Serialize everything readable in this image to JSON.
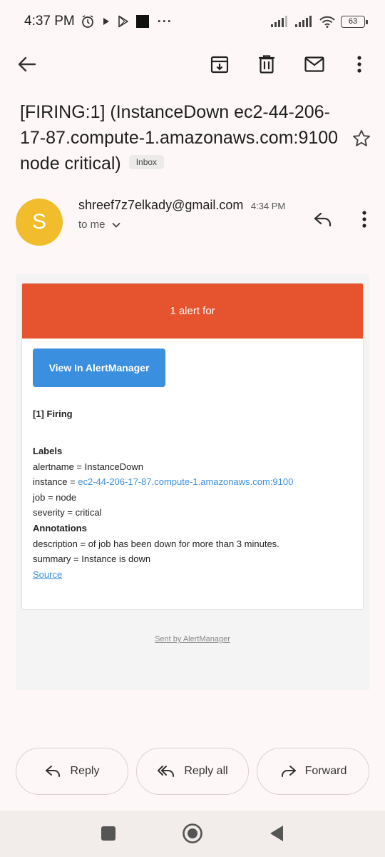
{
  "status_bar": {
    "time": "4:37 PM",
    "dots": "···",
    "battery": "63"
  },
  "email": {
    "subject": "[FIRING:1]  (InstanceDown ec2-44-206-17-87.compute-1.amazonaws.com:9100 node critical)",
    "label": "Inbox",
    "sender": {
      "initial": "S",
      "name": "shreef7z7elkady@gmail.com",
      "time": "4:34 PM",
      "recipient": "to me"
    },
    "body": {
      "header": "1 alert for",
      "button": "View In AlertManager",
      "firing": "[1] Firing",
      "labels_heading": "Labels",
      "alertname": "alertname = InstanceDown",
      "instance_prefix": "instance = ",
      "instance_value": "ec2-44-206-17-87.compute-1.amazonaws.com:9100",
      "job": "job = node",
      "severity": "severity = critical",
      "annotations_heading": "Annotations",
      "description": "description = of job has been down for more than 3 minutes.",
      "summary": "summary = Instance is down",
      "source": "Source",
      "footer": "Sent by AlertManager"
    }
  },
  "actions": {
    "reply": "Reply",
    "reply_all": "Reply all",
    "forward": "Forward"
  },
  "colors": {
    "alert_header": "#e6532f",
    "button": "#3a8fde",
    "avatar": "#f2bd2c"
  }
}
